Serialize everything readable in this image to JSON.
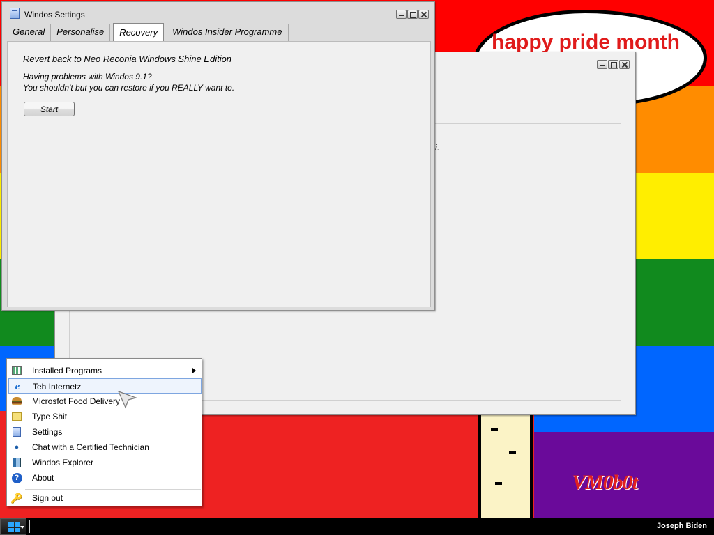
{
  "wallpaper": {
    "cloud_text": "happy pride month",
    "signature": "VM0b0t"
  },
  "background_window": {
    "fragment": "i."
  },
  "settings_window": {
    "title": "Windos Settings",
    "tabs": [
      {
        "label": "General",
        "active": false
      },
      {
        "label": "Personalise",
        "active": false
      },
      {
        "label": "Recovery",
        "active": true
      },
      {
        "label": "Windos Insider Programme",
        "active": false
      }
    ],
    "recovery": {
      "heading": "Revert back to Neo Reconia Windows Shine Edition",
      "problem_line": "Having problems with Windos 9.1?",
      "restore_line": "You shouldn't but you can restore if you REALLY want to.",
      "start_button": "Start"
    }
  },
  "start_menu": {
    "items": [
      {
        "label": "Installed Programs",
        "icon": "grid-icon",
        "submenu": true
      },
      {
        "label": "Teh Internetz",
        "icon": "internet-explorer-icon",
        "highlighted": true
      },
      {
        "label": "Microsfot Food Delivery",
        "icon": "burger-icon"
      },
      {
        "label": "Type Shit",
        "icon": "notepad-icon"
      },
      {
        "label": "Settings",
        "icon": "settings-icon"
      },
      {
        "label": "Chat with a Certified Technician",
        "icon": "technician-icon"
      },
      {
        "label": "Windos Explorer",
        "icon": "explorer-icon"
      },
      {
        "label": "About",
        "icon": "about-icon"
      }
    ],
    "sign_out": {
      "label": "Sign out",
      "icon": "key-icon"
    }
  },
  "taskbar": {
    "user": "Joseph Biden"
  },
  "colors": {
    "accent": "#2aa7ff",
    "menu_highlight_border": "#7ea6e0",
    "cloud_text": "#e01b1b"
  }
}
